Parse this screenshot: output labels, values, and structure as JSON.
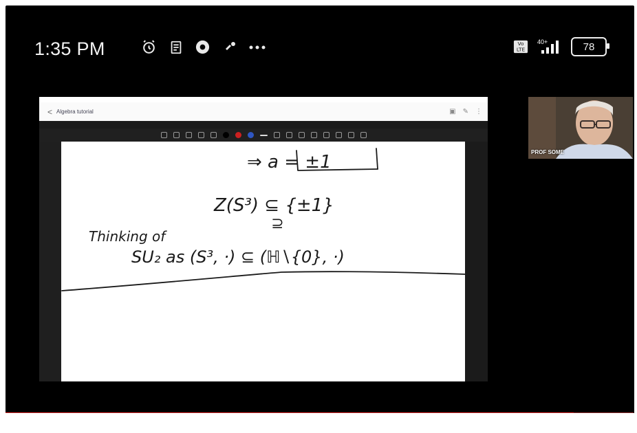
{
  "status_bar": {
    "time": "1:35 PM",
    "icons": [
      "alarm-icon",
      "notes-icon",
      "chrome-icon",
      "notification-icon",
      "more-icon"
    ],
    "network": {
      "top": "40+",
      "bottom": "LTE"
    },
    "battery": "78"
  },
  "shared_app": {
    "back_label": "<",
    "title": "Algebra tutorial"
  },
  "whiteboard": {
    "line1": "⇒ a = ±1",
    "line2": "Z(S³) ⊆ {±1}",
    "line3": "⊇",
    "line4_left": "Thinking of",
    "line5": "SU₂  as  (S³, ·) ⊆ (ℍ∖{0}, ·)"
  },
  "video_tile": {
    "name": "PROF SOME"
  },
  "playback": {
    "progress": 0.905
  },
  "colors": {
    "toolbar_red": "#cc2020",
    "toolbar_blue": "#2f56c2",
    "progress_red": "#e12828"
  }
}
